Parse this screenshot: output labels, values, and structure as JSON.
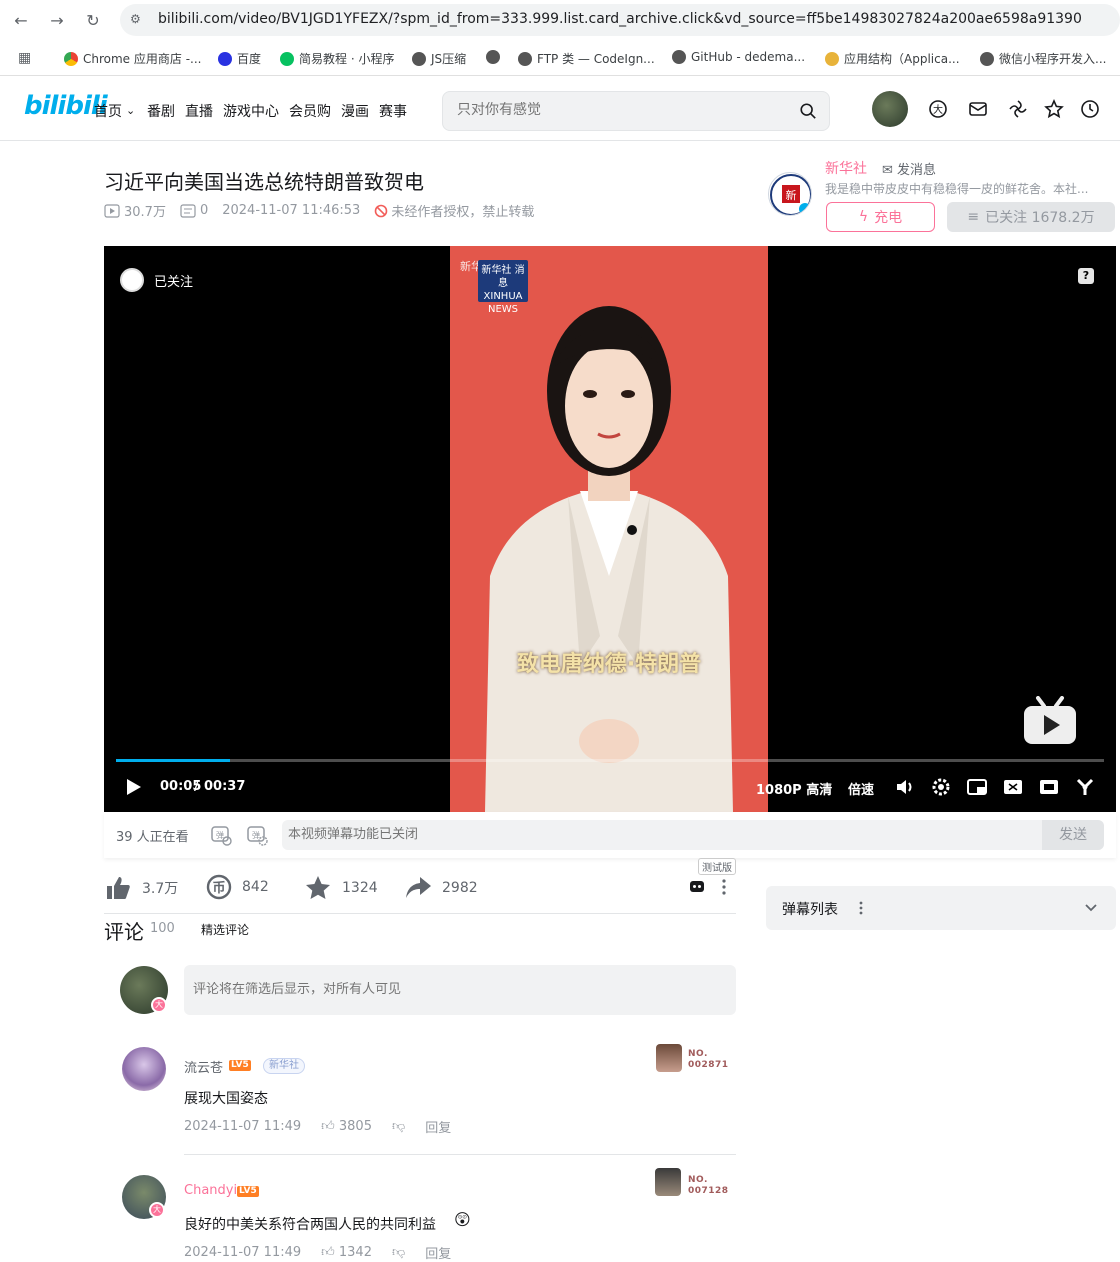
{
  "browser": {
    "url": "bilibili.com/video/BV1JGD1YFEZX/?spm_id_from=333.999.list.card_archive.click&vd_source=ff5be14983027824a200ae6598a91390",
    "bookmarks": [
      "Chrome 应用商店 -...",
      "百度",
      "简易教程 · 小程序",
      "JS压缩",
      "",
      "FTP 类 — CodeIgn...",
      "GitHub - dedema...",
      "应用结构（Applica...",
      "微信小程序开发入..."
    ]
  },
  "header": {
    "logo": "bilibili",
    "nav": [
      "首页",
      "番剧",
      "直播",
      "游戏中心",
      "会员购",
      "漫画",
      "赛事"
    ],
    "search_placeholder": "只对你有感觉"
  },
  "video": {
    "title": "习近平向美国当选总统特朗普致贺电",
    "views": "30.7万",
    "danmaku_count": "0",
    "date": "2024-11-07 11:46:53",
    "copyright": "未经作者授权，禁止转载"
  },
  "uploader": {
    "name": "新华社",
    "message": "发消息",
    "desc": "我是稳中带皮皮中有稳稳得一皮的鲜花舍。本社...",
    "charge": "充电",
    "follow": "已关注 1678.2万"
  },
  "player": {
    "followed": "已关注",
    "watermark": "新华社 bilibili",
    "wm_box": "新华社 消 息 XINHUA NEWS",
    "subtitle": "致电唐纳德·特朗普",
    "progress": 0.115,
    "current": "00:05",
    "sep": "/",
    "duration": "00:37",
    "quality": "1080P 高清",
    "speed": "倍速"
  },
  "danmaku_bar": {
    "viewers": "39 人正在看",
    "placeholder": "本视频弹幕功能已关闭",
    "send": "发送"
  },
  "toolbar": {
    "like": "3.7万",
    "coin": "842",
    "fav": "1324",
    "share": "2982",
    "beta": "测试版"
  },
  "danmaku_list": {
    "title": "弹幕列表"
  },
  "comments": {
    "title": "评论",
    "count": "100",
    "filter": "精选评论",
    "placeholder": "评论将在筛选后显示，对所有人可见",
    "me_level": "大",
    "items": [
      {
        "name": "流云苍",
        "level": "LV5",
        "fan_tag": "新华社",
        "no_label": "NO.",
        "no_value": "002871",
        "text": "展现大国姿态",
        "time": "2024-11-07 11:49",
        "likes": "3805",
        "reply": "回复"
      },
      {
        "name": "Chandyi",
        "level": "LV5",
        "no_label": "NO.",
        "no_value": "007128",
        "text": "良好的中美关系符合两国人民的共同利益",
        "time": "2024-11-07 11:49",
        "likes": "1342",
        "reply": "回复",
        "badge": "大"
      }
    ]
  },
  "colors": {
    "brand": "#00aeec",
    "pink": "#fb7299",
    "text": "#18191c",
    "muted": "#9499a0"
  }
}
